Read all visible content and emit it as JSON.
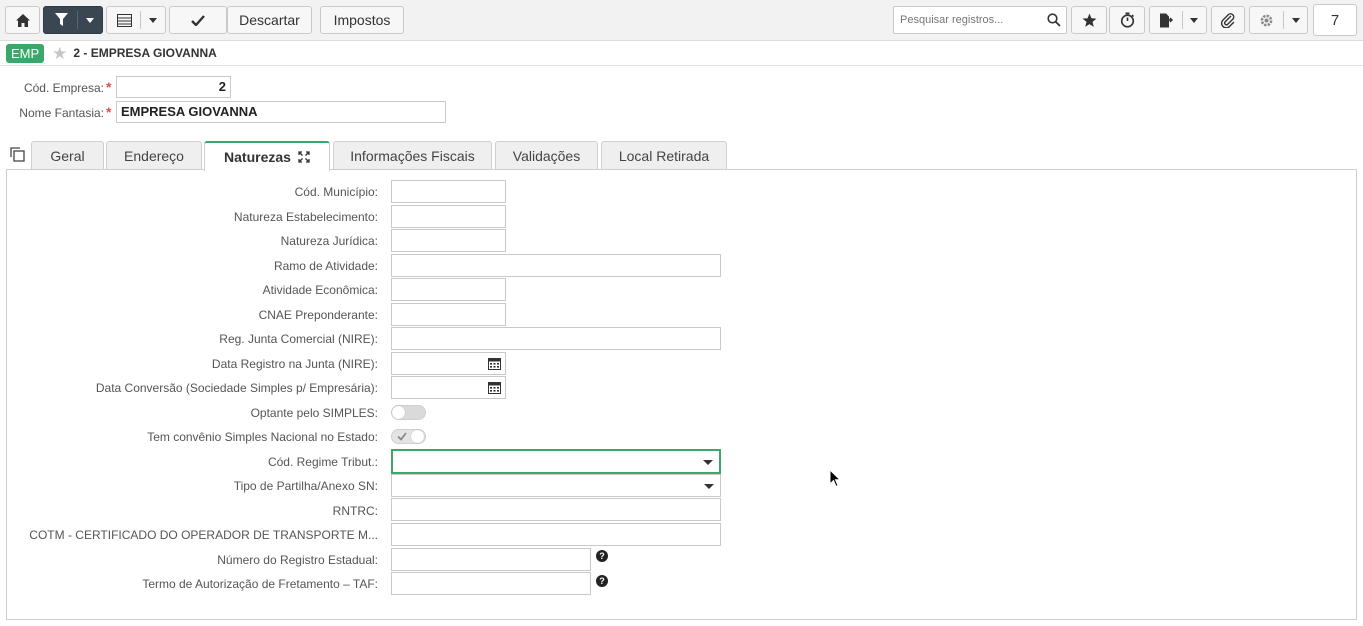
{
  "toolbar": {
    "discard_label": "Descartar",
    "taxes_label": "Impostos",
    "search_placeholder": "Pesquisar registros...",
    "page_number": "7"
  },
  "breadcrumb": {
    "badge": "EMP",
    "title": "2 - EMPRESA GIOVANNA"
  },
  "header": {
    "cod_empresa_label": "Cód. Empresa:",
    "cod_empresa_value": "2",
    "nome_fantasia_label": "Nome Fantasia:",
    "nome_fantasia_value": "EMPRESA GIOVANNA"
  },
  "tabs": [
    {
      "label": "Geral"
    },
    {
      "label": "Endereço"
    },
    {
      "label": "Naturezas"
    },
    {
      "label": "Informações Fiscais"
    },
    {
      "label": "Validações"
    },
    {
      "label": "Local Retirada"
    }
  ],
  "form": {
    "cod_municipio": "Cód. Município:",
    "natureza_estabelecimento": "Natureza Estabelecimento:",
    "natureza_juridica": "Natureza Jurídica:",
    "ramo_atividade": "Ramo de Atividade:",
    "atividade_economica": "Atividade Econômica:",
    "cnae_preponderante": "CNAE Preponderante:",
    "reg_junta_comercial": "Reg. Junta Comercial (NIRE):",
    "data_registro_junta": "Data Registro na Junta (NIRE):",
    "data_conversao": "Data Conversão (Sociedade Simples p/ Empresária):",
    "optante_simples": "Optante pelo SIMPLES:",
    "convenio_simples": "Tem convênio Simples Nacional no Estado:",
    "cod_regime_tribut": "Cód. Regime Tribut.:",
    "tipo_partilha": "Tipo de Partilha/Anexo SN:",
    "rntrc": "RNTRC:",
    "cotm": "COTM - CERTIFICADO DO OPERADOR DE TRANSPORTE M...",
    "numero_registro_estadual": "Número do Registro Estadual:",
    "termo_autorizacao": "Termo de Autorização de Fretamento – TAF:"
  },
  "colors": {
    "accent": "#3aa86b",
    "toolbar_dark": "#3a4752",
    "required": "#d9534f"
  }
}
